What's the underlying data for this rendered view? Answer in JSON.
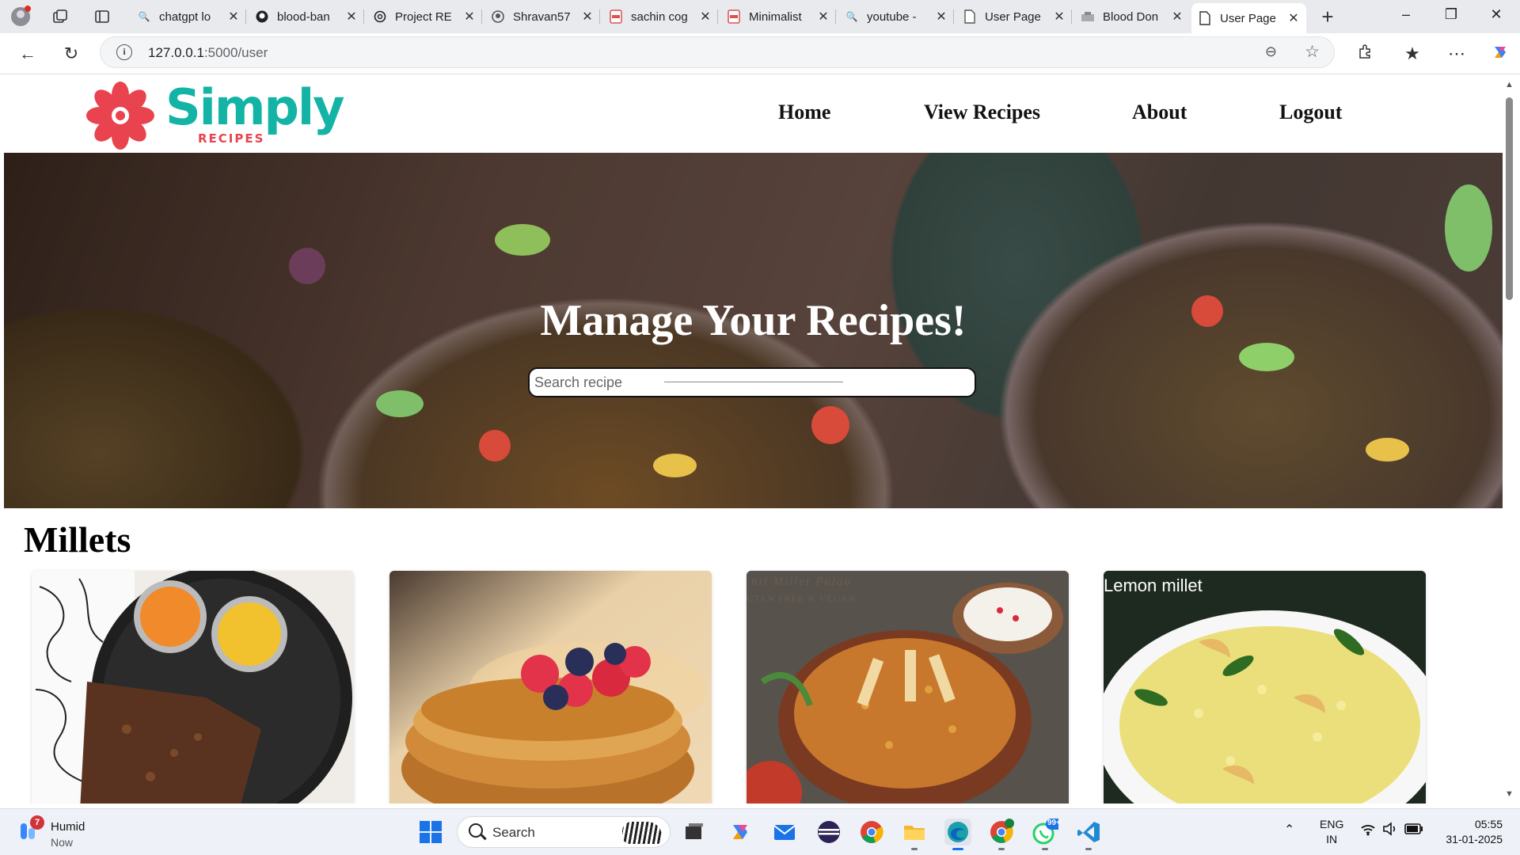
{
  "browser": {
    "tabs": [
      {
        "title": "chatgpt lo",
        "icon": "search-icon"
      },
      {
        "title": "blood-ban",
        "icon": "github-icon"
      },
      {
        "title": "Project RE",
        "icon": "openai-icon"
      },
      {
        "title": "Shravan57",
        "icon": "github-icon"
      },
      {
        "title": "sachin cog",
        "icon": "pdf-icon"
      },
      {
        "title": "Minimalist",
        "icon": "pdf-icon"
      },
      {
        "title": "youtube -",
        "icon": "search-icon"
      },
      {
        "title": "User Page",
        "icon": "page-icon"
      },
      {
        "title": "Blood Don",
        "icon": "page-icon"
      },
      {
        "title": "User Page",
        "icon": "page-icon",
        "active": true
      }
    ],
    "url_host": "127.0.0.1",
    "url_path": ":5000/user"
  },
  "site": {
    "logo_main": "Simply",
    "logo_sub": "RECIPES",
    "nav": {
      "home": "Home",
      "view_recipes": "View Recipes",
      "about": "About",
      "logout": "Logout"
    },
    "hero_title": "Manage Your Recipes!",
    "search_placeholder": "Search recipe",
    "section_title": "Millets",
    "cards": [
      {
        "label": ""
      },
      {
        "label": ""
      },
      {
        "label": "nil Millet Pulao",
        "sub": "UTEN FREE & VEGAN"
      },
      {
        "label": "Lemon millet"
      }
    ],
    "colors": {
      "logo_teal": "#13b3a5",
      "logo_red": "#e8434f"
    }
  },
  "taskbar": {
    "weather_title": "Humid",
    "weather_sub": "Now",
    "weather_badge": "7",
    "search_label": "Search",
    "whatsapp_badge": "99+",
    "lang_1": "ENG",
    "lang_2": "IN",
    "time": "05:55",
    "date": "31-01-2025"
  }
}
